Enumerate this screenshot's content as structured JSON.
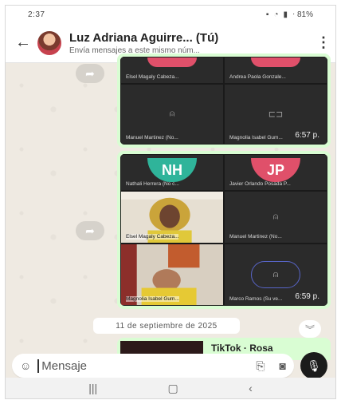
{
  "status_bar": {
    "time": "2:37",
    "right": "⋅ 81%"
  },
  "header": {
    "title": "Luz Adriana Aguirre... (Tú)",
    "subtitle": "Envía mensajes a este mismo núm..."
  },
  "message1": {
    "tiles": [
      {
        "name": "Elsel Magaly Cabeza..."
      },
      {
        "name": "Andrea Paola Gonzale..."
      },
      {
        "name": "Manuel Martinez (No..."
      },
      {
        "name": "Magnolia Isabel Gum..."
      }
    ],
    "time": "6:57 p."
  },
  "message2": {
    "tiles": [
      {
        "name": "Nathali Herrera (No c...",
        "initials": "NH",
        "color": "#2fb49a"
      },
      {
        "name": "Javier Orlando Posada P...",
        "initials": "JP",
        "color": "#e0506a"
      },
      {
        "name": "Elsel Magaly Cabeza..."
      },
      {
        "name": "Manuel Martinez (No..."
      },
      {
        "name": "Magnolia Isabel Gum..."
      },
      {
        "name": "Marco Ramos (Su ve..."
      }
    ],
    "time": "6:59 p."
  },
  "date_chip": "11 de septiembre de 2025",
  "tiktok": {
    "title": "TikTok · Rosa"
  },
  "composer": {
    "placeholder": "Mensaje"
  },
  "colors": {
    "bubble": "#d9fdd3",
    "chat_bg": "#efeae2",
    "accent": "#1b1b1b"
  }
}
